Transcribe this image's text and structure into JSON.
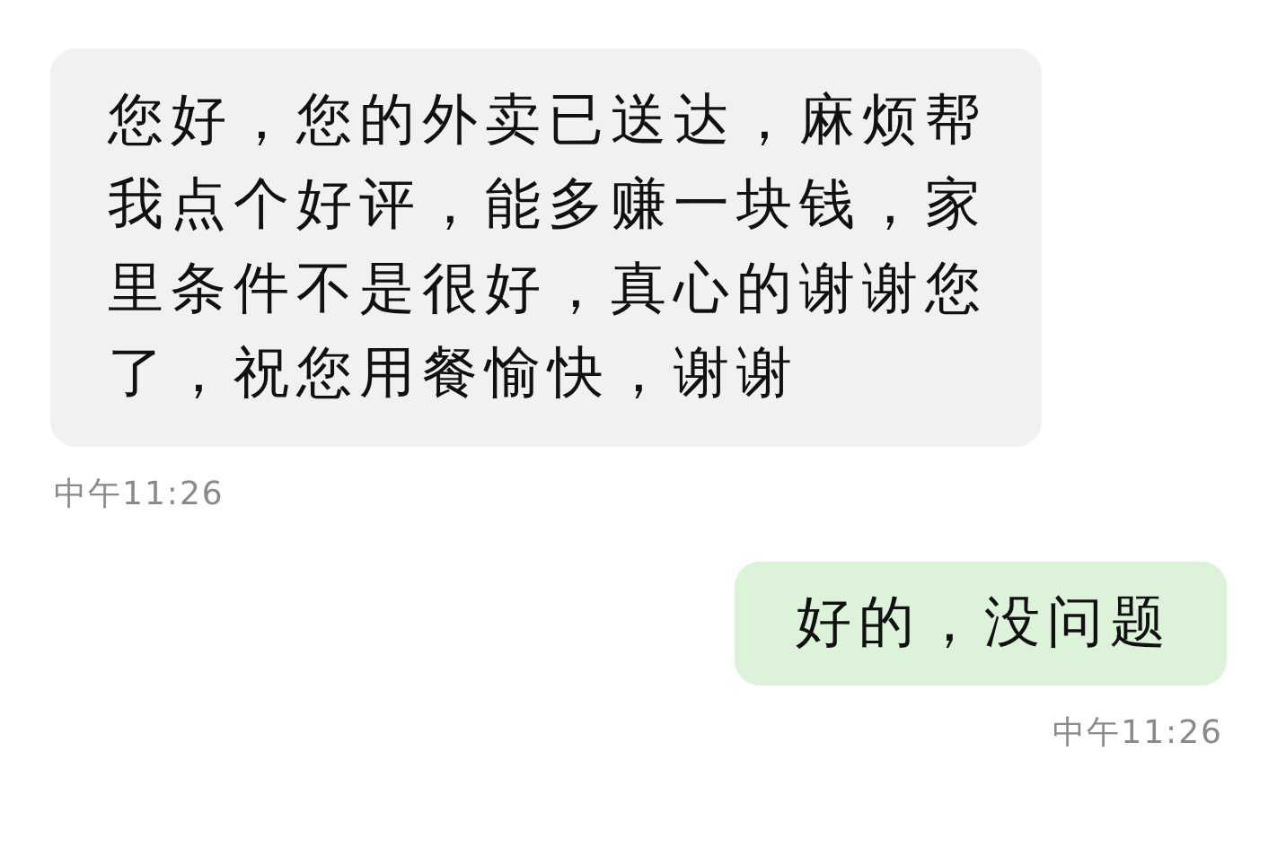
{
  "messages": [
    {
      "kind": "received",
      "text": "您好，您的外卖已送达，麻烦帮我点个好评，能多赚一块钱，家里条件不是很好，真心的谢谢您了，祝您用餐愉快，谢谢",
      "time": "中午11:26"
    },
    {
      "kind": "sent",
      "text": "好的，没问题",
      "time": "中午11:26"
    }
  ]
}
